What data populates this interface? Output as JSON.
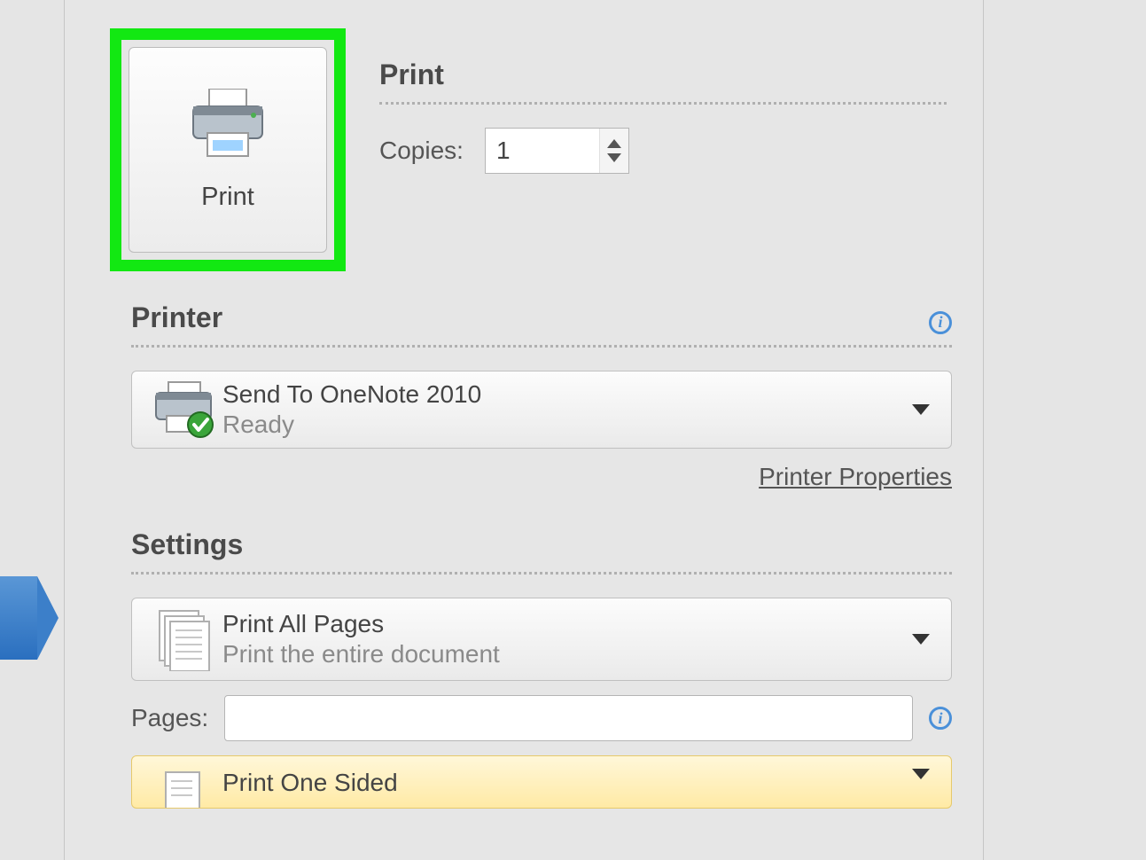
{
  "print": {
    "buttonLabel": "Print",
    "sectionHeading": "Print",
    "copiesLabel": "Copies:",
    "copiesValue": "1"
  },
  "printer": {
    "heading": "Printer",
    "selectedName": "Send To OneNote 2010",
    "selectedStatus": "Ready",
    "propertiesLink": "Printer Properties"
  },
  "settings": {
    "heading": "Settings",
    "rangePrimary": "Print All Pages",
    "rangeSecondary": "Print the entire document",
    "pagesLabel": "Pages:",
    "pagesValue": "",
    "sidesPrimary": "Print One Sided"
  }
}
